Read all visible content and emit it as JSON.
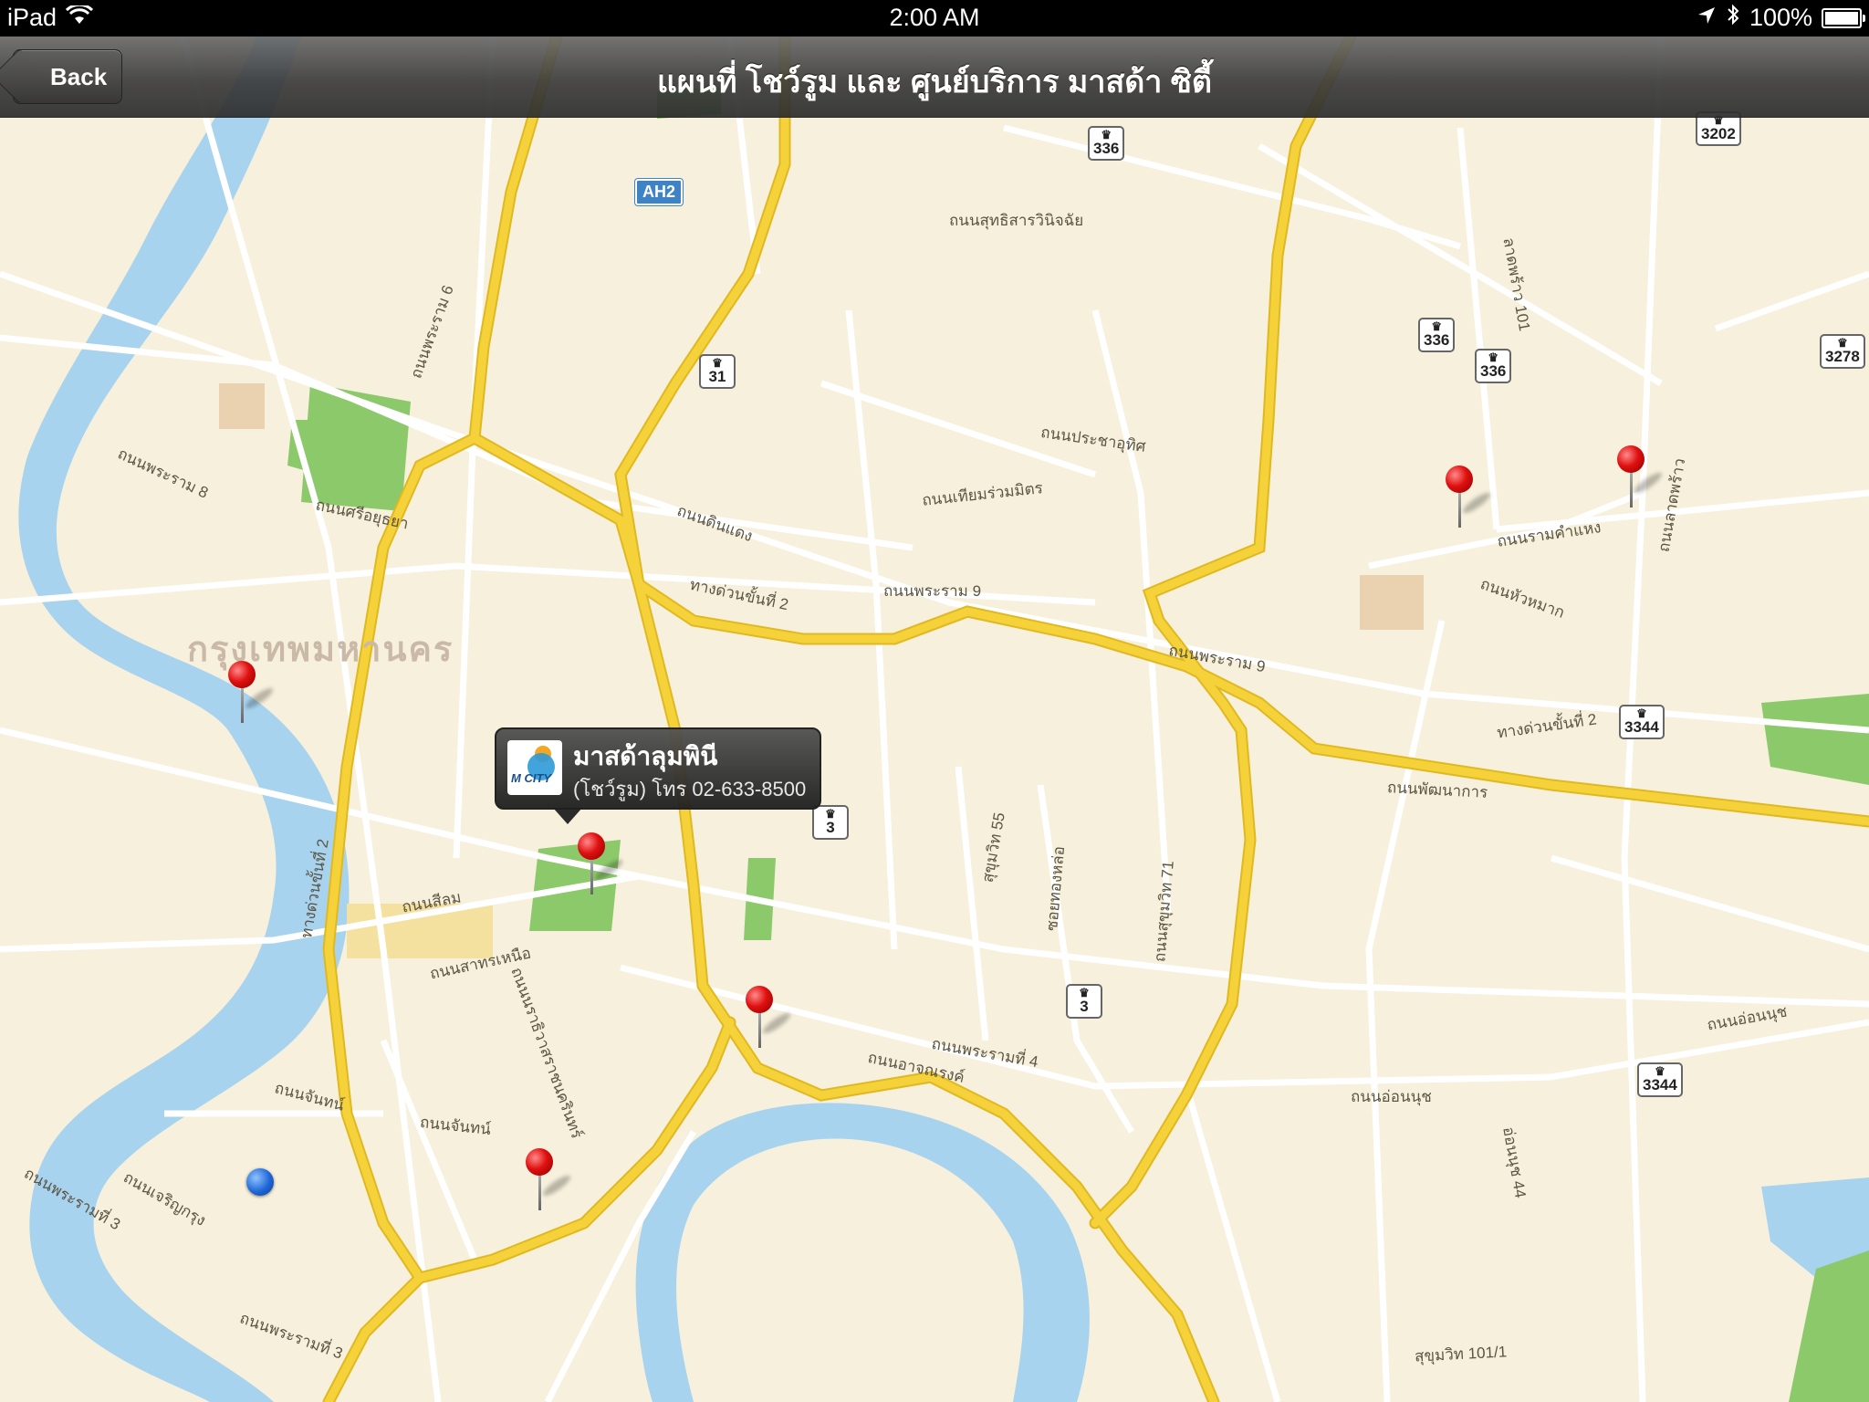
{
  "status_bar": {
    "device": "iPad",
    "time": "2:00 AM",
    "battery": "100%",
    "battery_level": 1.0
  },
  "nav": {
    "back_label": "Back",
    "title": "แผนที่ โชว์รูม และ ศูนย์บริการ มาสด้า ซิตี้"
  },
  "callout": {
    "title": "มาสด้าลุมพินี",
    "subtitle": "(โชว์รูม) โทร 02-633-8500",
    "logo_text": "M CITY"
  },
  "map": {
    "city_label": "กรุงเทพมหานคร",
    "route_shields": [
      "336",
      "3202",
      "31",
      "336",
      "336",
      "3278",
      "3",
      "3",
      "3344",
      "3344"
    ],
    "ah_shield": "AH2",
    "road_labels": [
      "ถนนสุทธิสารวินิจฉัย",
      "ถนนประชาอุทิศ",
      "ถนนเทียมร่วมมิตร",
      "ถนนดินแดง",
      "ถนนพระราม 9",
      "ทางด่วนขั้นที่ 2",
      "ถนนพระราม 9",
      "ทางด่วนขั้นที่ 2",
      "ถนนพัฒนาการ",
      "ถนนรามคำแหง",
      "ถนนหัวหมาก",
      "ลาดพร้าว 101",
      "ถนนสาทรเหนือ",
      "ถนนสีลม",
      "ถนนพระรามที่ 4",
      "ถนนอาจณรงค์",
      "ถนนอ่อนนุช",
      "ถนนอ่อนนุช",
      "อ่อนนุช 44",
      "สุขุมวิท 101/1",
      "ถนนจันทน์",
      "ถนนจันทน์",
      "ถนนพระรามที่ 3",
      "ถนนพระรามที่ 3",
      "ถนนเจริญกรุง",
      "ถนนพระราม 8",
      "ถนนศรีอยุธยา",
      "ถนนพระราม 6",
      "สุขุมวิท 55",
      "ถนนสุขุมวิท 71",
      "ซอยทองหล่อ",
      "ทางด่วนขั้นที่ 2",
      "ถนนลาดพร้าว",
      "ถนนนราธิวาสราชนครินทร์"
    ]
  },
  "colors": {
    "land": "#f6f0dc",
    "water": "#a8d3ee",
    "park": "#8cc96b",
    "expressway": "#f3cd2a",
    "pin": "#e01010",
    "user_location": "#1f66d6"
  }
}
